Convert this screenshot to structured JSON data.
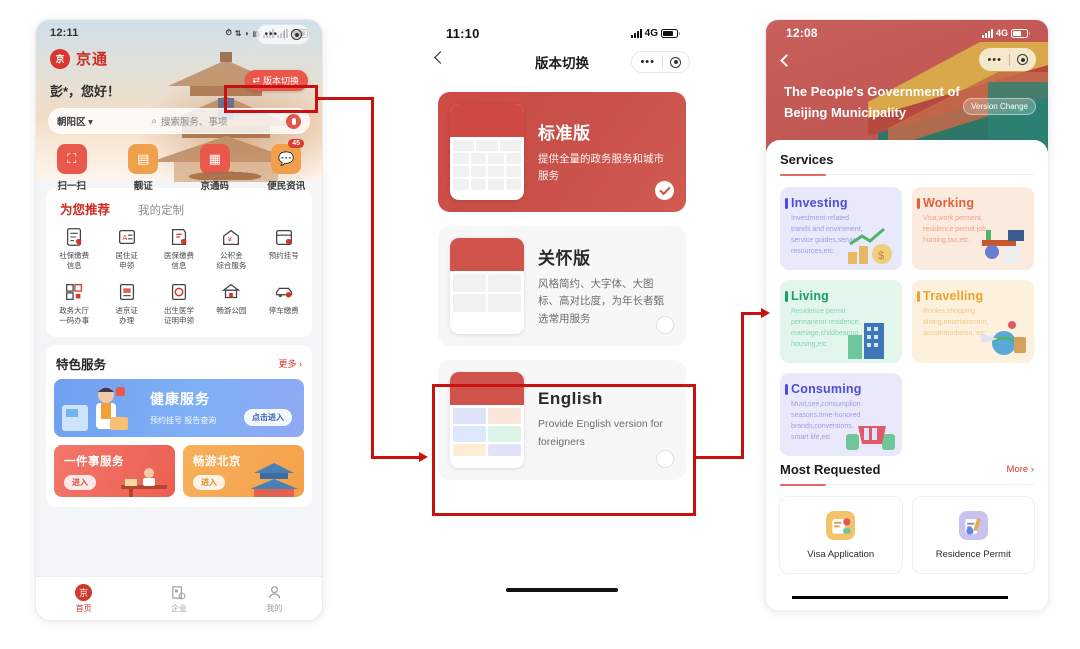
{
  "phone1": {
    "name": "jingtong-home",
    "statusbar": {
      "time": "12:11",
      "network": "",
      "icons": [
        "alarm-icon",
        "data-rate",
        "wifi-icon",
        "nfc-icon",
        "signal-1",
        "signal-2"
      ],
      "battery": "97"
    },
    "brand": {
      "logo_text": "京",
      "name": "京通"
    },
    "capsule": {
      "dots": "•••",
      "target": "◉"
    },
    "greeting": "彭*，您好！",
    "version_button": {
      "label": "版本切换",
      "icon": "switch-icon"
    },
    "search": {
      "district": "朝阳区",
      "placeholder": "搜索服务、事项",
      "mic": "mic-icon"
    },
    "quick_actions": [
      {
        "label": "扫一扫",
        "icon": "scan-icon",
        "color": "#e8584b",
        "badge": ""
      },
      {
        "label": "靓证",
        "icon": "id-card-icon",
        "color": "#f0a04a",
        "badge": ""
      },
      {
        "label": "京通码",
        "icon": "qr-code-icon",
        "color": "#e8584b",
        "badge": ""
      },
      {
        "label": "便民资讯",
        "icon": "news-icon",
        "color": "#f0a04a",
        "badge": "45"
      }
    ],
    "tabs": [
      {
        "label": "为您推荐",
        "active": true
      },
      {
        "label": "我的定制",
        "active": false
      }
    ],
    "services": [
      {
        "line1": "社保缴费",
        "line2": "信息",
        "icon": "clipboard-icon"
      },
      {
        "line1": "居住证",
        "line2": "申领",
        "icon": "id-doc-icon"
      },
      {
        "line1": "医保缴费",
        "line2": "信息",
        "icon": "medical-icon"
      },
      {
        "line1": "公积金",
        "line2": "综合服务",
        "icon": "house-fund-icon"
      },
      {
        "line1": "预约挂号",
        "line2": "",
        "icon": "calendar-icon"
      },
      {
        "line1": "政务大厅",
        "line2": "一码办事",
        "icon": "qr-hall-icon"
      },
      {
        "line1": "进京证",
        "line2": "办理",
        "icon": "permit-icon"
      },
      {
        "line1": "出生医学",
        "line2": "证明申领",
        "icon": "birth-cert-icon"
      },
      {
        "line1": "畅游公园",
        "line2": "",
        "icon": "park-icon"
      },
      {
        "line1": "停车缴费",
        "line2": "",
        "icon": "car-icon"
      }
    ],
    "featured": {
      "title": "特色服务",
      "more": "更多 ›"
    },
    "health_banner": {
      "title": "健康服务",
      "subtitle": "预约挂号 报告查询",
      "button": "点击进入"
    },
    "small_banners": [
      {
        "title": "一件事服务",
        "button": "进入"
      },
      {
        "title": "畅游北京",
        "button": "进入"
      }
    ],
    "tabbar": [
      {
        "label": "首页",
        "icon": "home-icon",
        "active": true
      },
      {
        "label": "企业",
        "icon": "enterprise-icon",
        "active": false
      },
      {
        "label": "我的",
        "icon": "person-icon",
        "active": false
      }
    ]
  },
  "phone2": {
    "name": "version-switch",
    "statusbar": {
      "time": "11:10",
      "network": "4G"
    },
    "nav": {
      "back": "back-chevron-icon",
      "title": "版本切换"
    },
    "capsule": {
      "dots": "•••",
      "target": "◉"
    },
    "versions": [
      {
        "title": "标准版",
        "desc": "提供全量的政务服务和城市服务",
        "selected": true
      },
      {
        "title": "关怀版",
        "desc": "风格简约、大字体、大图标、高对比度，为年长者甄选常用服务",
        "selected": false
      },
      {
        "title": "English",
        "desc": "Provide English version for foreigners",
        "selected": false
      }
    ]
  },
  "phone3": {
    "name": "english-version-home",
    "statusbar": {
      "time": "12:08",
      "network": "4G"
    },
    "header": {
      "title": "The People's Government of Beijing Municipality",
      "version_change": "Version Change",
      "back": "back-chevron-icon"
    },
    "capsule": {
      "dots": "•••",
      "target": "◉"
    },
    "services_section": {
      "title": "Services"
    },
    "services": [
      {
        "title": "Investing",
        "desc": "Investment-related trands and enviroment, service guides,service resources,etc.",
        "color": "#4b4fd8",
        "bg": "#e8e9fb",
        "art": "chart-coins-icon"
      },
      {
        "title": "Working",
        "desc": "Visa,work perment, residence permit job, hunting,tax,etc.",
        "color": "#e0603f",
        "bg": "#fbeade",
        "art": "desk-icon"
      },
      {
        "title": "Living",
        "desc": "Residence permit permanemt residence, marriage,childbearing, housing,etc",
        "color": "#17a06a",
        "bg": "#e2f6ec",
        "art": "building-icon"
      },
      {
        "title": "Travelling",
        "desc": "Roules,shopping dining,entertainment, accommodation, etc",
        "color": "#eda42b",
        "bg": "#fdf0dd",
        "art": "travel-icon"
      },
      {
        "title": "Consuming",
        "desc": "Must,see,consumplion seasons,time-honored brands,conventions, smart life,etc",
        "color": "#4b4fd8",
        "bg": "#e9e9fb",
        "art": "cart-icon"
      }
    ],
    "most_requested": {
      "title": "Most Requested",
      "more": "More ›"
    },
    "requested": [
      {
        "label": "Visa Application",
        "icon": "visa-folder-icon"
      },
      {
        "label": "Residence Permit",
        "icon": "residence-doc-icon"
      }
    ]
  },
  "annotations": {
    "color": "#c9120f",
    "boxes": [
      "version-switch-button-highlight",
      "english-card-highlight"
    ],
    "connectors": [
      "home-to-english-card",
      "english-card-to-english-home"
    ]
  }
}
